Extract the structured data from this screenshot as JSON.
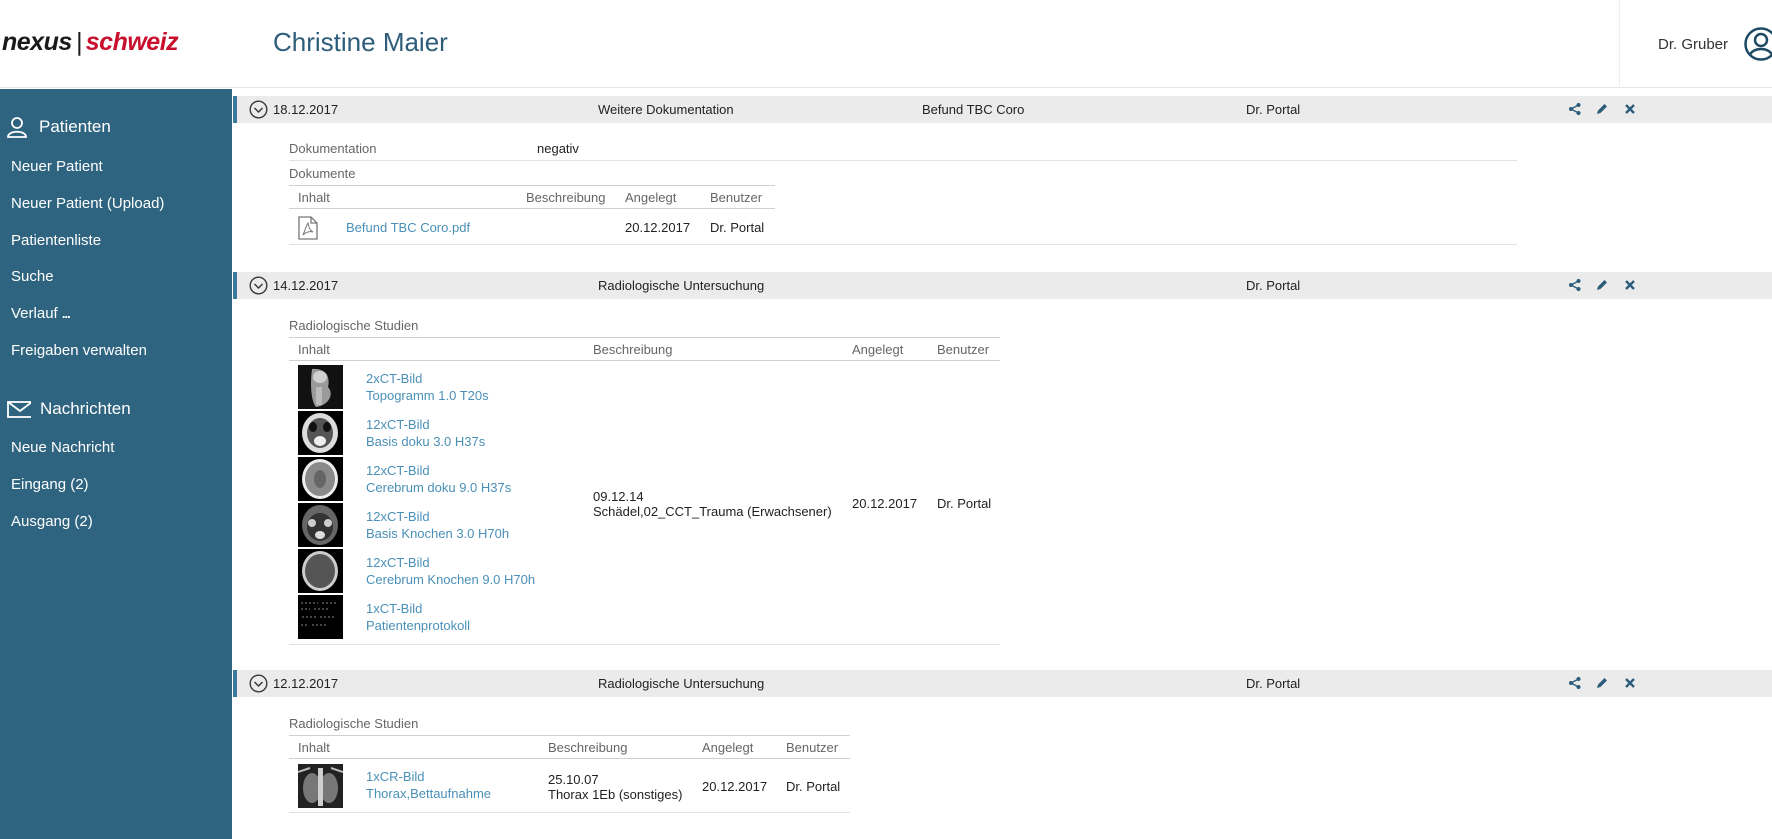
{
  "header": {
    "logo_part1": "nexus",
    "logo_sep": "|",
    "logo_part2": "schweiz",
    "patient_name": "Christine Maier",
    "user_name": "Dr. Gruber"
  },
  "sidebar": {
    "patients_section": "Patienten",
    "patients_items": [
      "Neuer Patient",
      "Neuer Patient (Upload)",
      "Patientenliste",
      "Suche",
      "Verlauf",
      "Freigaben verwalten"
    ],
    "verlauf_dots": "...",
    "messages_section": "Nachrichten",
    "messages_items": [
      "Neue Nachricht",
      "Eingang (2)",
      "Ausgang (2)"
    ]
  },
  "entries": [
    {
      "date": "18.12.2017",
      "type": "Weitere Dokumentation",
      "title": "Befund TBC Coro",
      "doctor": "Dr. Portal",
      "doc_label": "Dokumentation",
      "doc_value": "negativ",
      "docs_label": "Dokumente",
      "headers": [
        "Inhalt",
        "Beschreibung",
        "Angelegt",
        "Benutzer"
      ],
      "row": {
        "file": "Befund TBC Coro.pdf",
        "created": "20.12.2017",
        "user": "Dr. Portal"
      }
    },
    {
      "date": "14.12.2017",
      "type": "Radiologische Untersuchung",
      "doctor": "Dr. Portal",
      "studies_label": "Radiologische Studien",
      "headers": [
        "Inhalt",
        "Beschreibung",
        "Angelegt",
        "Benutzer"
      ],
      "images": [
        {
          "count": "2xCT-Bild",
          "name": "Topogramm 1.0 T20s"
        },
        {
          "count": "12xCT-Bild",
          "name": "Basis doku 3.0 H37s"
        },
        {
          "count": "12xCT-Bild",
          "name": "Cerebrum doku 9.0 H37s"
        },
        {
          "count": "12xCT-Bild",
          "name": "Basis Knochen 3.0 H70h"
        },
        {
          "count": "12xCT-Bild",
          "name": "Cerebrum Knochen 9.0 H70h"
        },
        {
          "count": "1xCT-Bild",
          "name": "Patientenprotokoll"
        }
      ],
      "desc_date": "09.12.14",
      "desc_text": "Schädel,02_CCT_Trauma (Erwachsener)",
      "created": "20.12.2017",
      "user": "Dr. Portal"
    },
    {
      "date": "12.12.2017",
      "type": "Radiologische Untersuchung",
      "doctor": "Dr. Portal",
      "studies_label": "Radiologische Studien",
      "headers": [
        "Inhalt",
        "Beschreibung",
        "Angelegt",
        "Benutzer"
      ],
      "images": [
        {
          "count": "1xCR-Bild",
          "name": "Thorax,Bettaufnahme"
        }
      ],
      "desc_date": "25.10.07",
      "desc_text": "Thorax 1Eb (sonstiges)",
      "created": "20.12.2017",
      "user": "Dr. Portal"
    }
  ],
  "colors": {
    "sidebar": "#2f6480",
    "accent_link": "#4a90b8",
    "brand_red": "#c8102e",
    "title_blue": "#2d5d7b"
  },
  "icons": [
    "user-icon",
    "envelope-icon",
    "avatar-icon",
    "chevron-circle-icon",
    "share-icon",
    "pencil-icon",
    "close-icon",
    "pdf-icon"
  ]
}
